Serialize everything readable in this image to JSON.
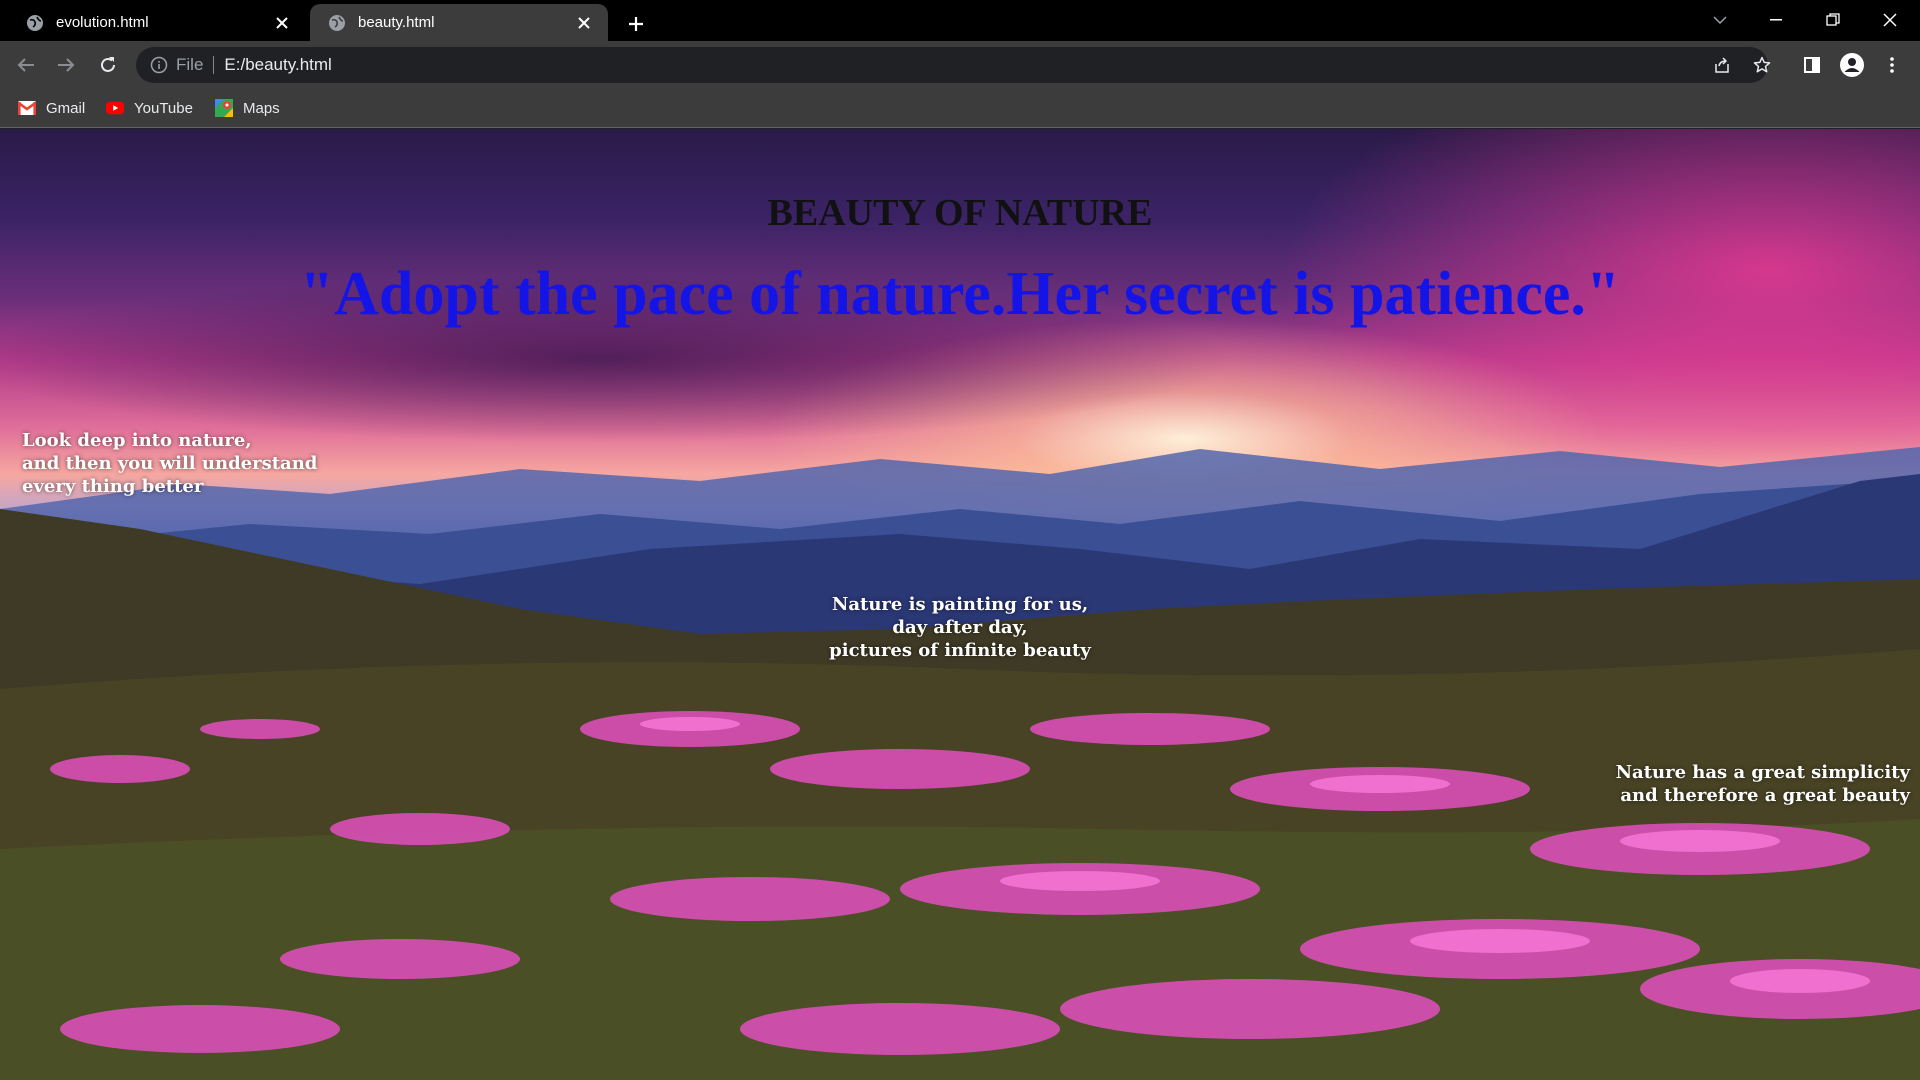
{
  "tabs": [
    {
      "title": "evolution.html",
      "active": false
    },
    {
      "title": "beauty.html",
      "active": true
    }
  ],
  "toolbar": {
    "scheme_label": "File",
    "url": "E:/beauty.html"
  },
  "bookmarks": [
    {
      "label": "Gmail",
      "icon": "gmail-icon"
    },
    {
      "label": "YouTube",
      "icon": "youtube-icon"
    },
    {
      "label": "Maps",
      "icon": "maps-icon"
    }
  ],
  "page": {
    "heading": "BEAUTY OF NATURE",
    "quote": "\"Adopt the pace of nature.Her secret is patience.\"",
    "blurb_left": [
      "Look deep into nature,",
      "and then you will understand",
      "every thing better"
    ],
    "blurb_center": [
      "Nature is painting for us,",
      "day after day,",
      "pictures of infinite beauty"
    ],
    "blurb_right": [
      "Nature has a great simplicity",
      "and therefore a great beauty"
    ]
  },
  "colors": {
    "quote": "#1414e6",
    "heading": "#111111",
    "tab_strip": "#000000",
    "toolbar": "#3c3c3c"
  }
}
